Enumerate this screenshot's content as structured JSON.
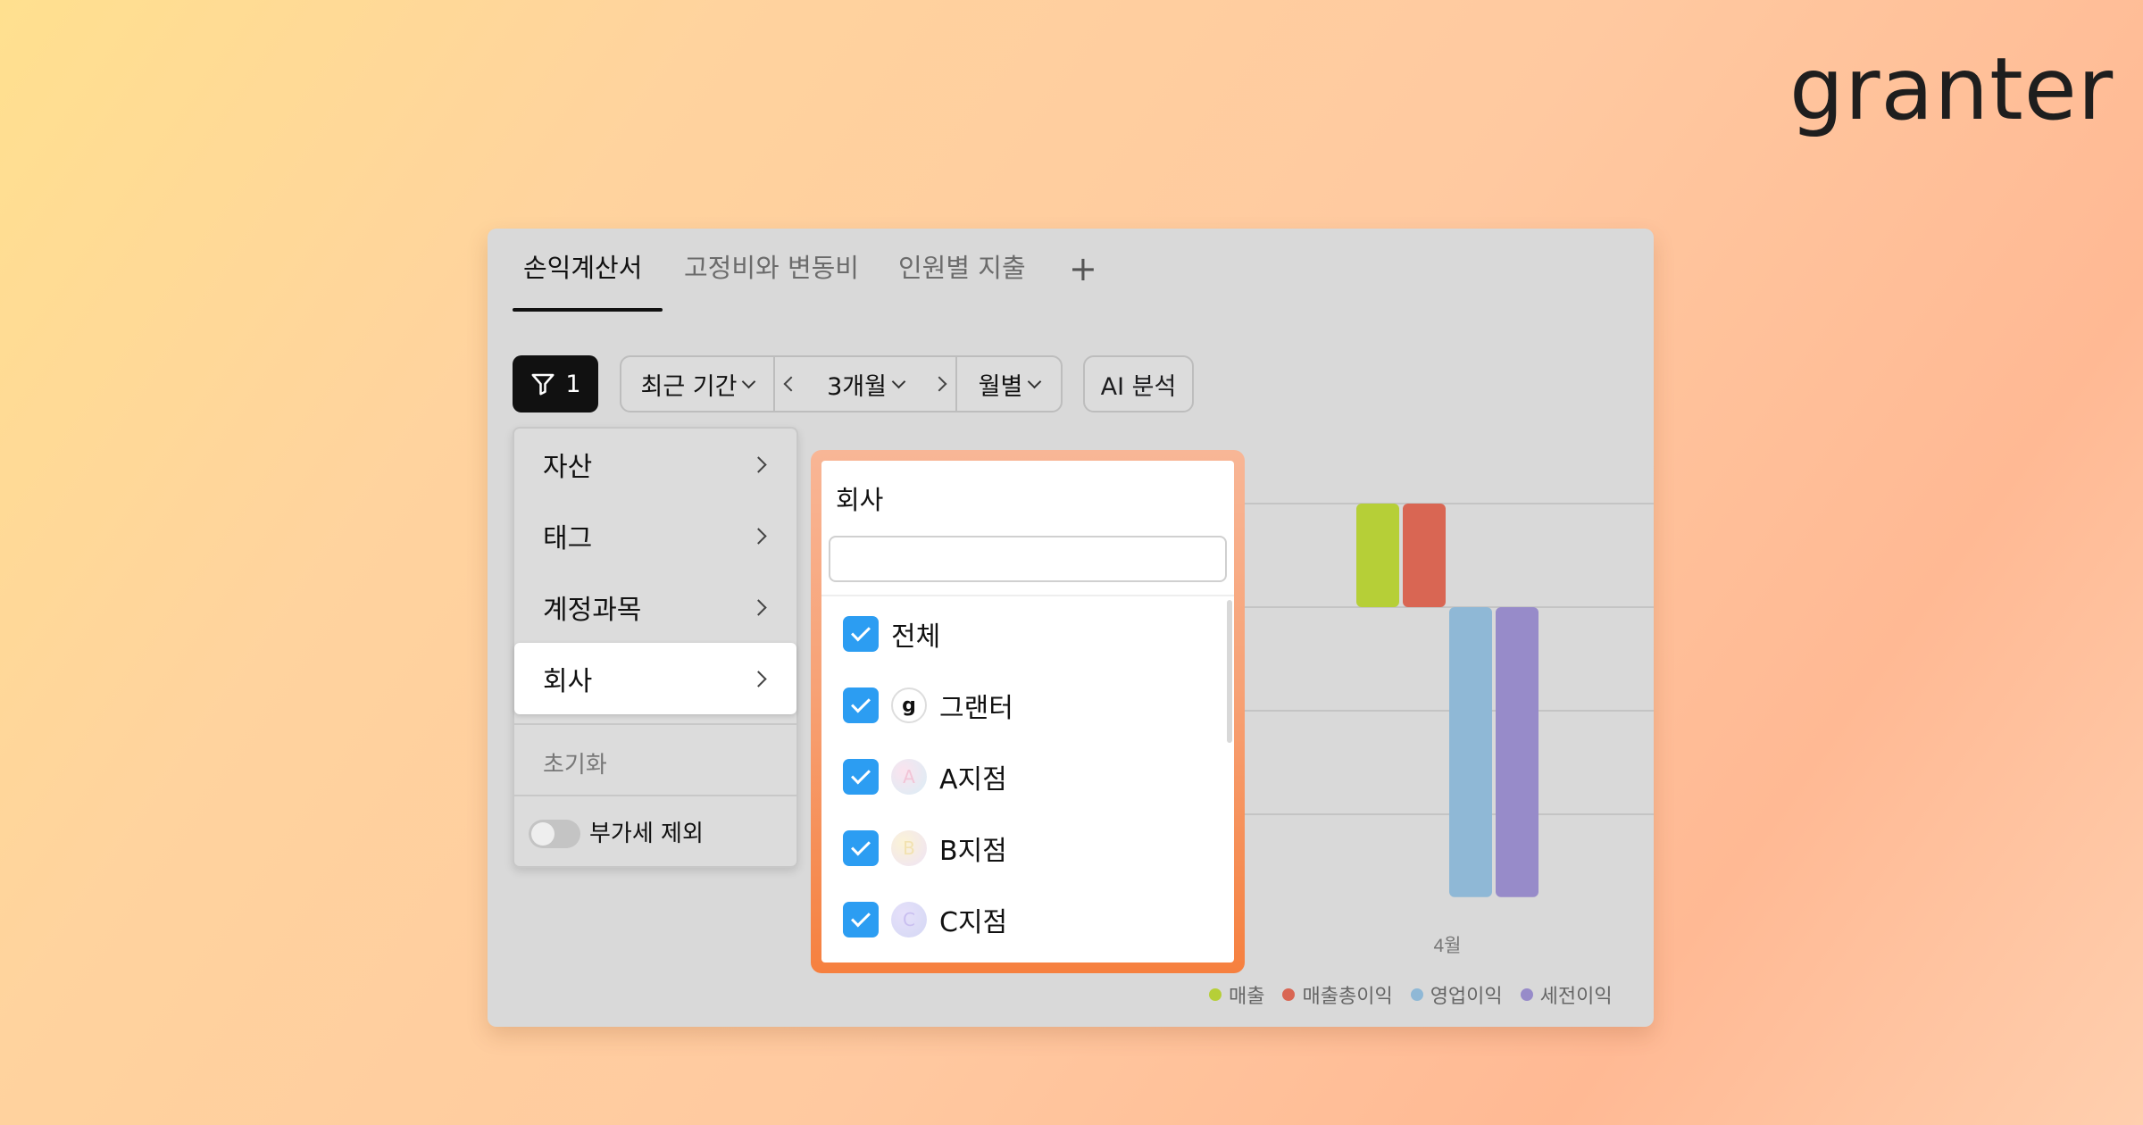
{
  "brand": {
    "logo_text": "granter"
  },
  "tabs": [
    {
      "label": "손익계산서",
      "active": true
    },
    {
      "label": "고정비와 변동비",
      "active": false
    },
    {
      "label": "인원별 지출",
      "active": false
    }
  ],
  "tab_add_label": "+",
  "toolbar": {
    "filter_count": "1",
    "period_label": "최근 기간",
    "range_label": "3개월",
    "granularity_label": "월별",
    "ai_button_label": "AI 분석"
  },
  "filter_menu": {
    "items": [
      {
        "label": "자산"
      },
      {
        "label": "태그"
      },
      {
        "label": "계정과목"
      },
      {
        "label": "회사",
        "selected": true
      }
    ],
    "reset_label": "초기화",
    "vat_toggle": {
      "label": "부가세 제외",
      "on": false
    }
  },
  "company_popup": {
    "title": "회사",
    "search_value": "",
    "options": [
      {
        "label": "전체",
        "checked": true,
        "logo": ""
      },
      {
        "label": "그랜터",
        "checked": true,
        "logo": "g"
      },
      {
        "label": "A지점",
        "checked": true,
        "logo": "A"
      },
      {
        "label": "B지점",
        "checked": true,
        "logo": "B"
      },
      {
        "label": "C지점",
        "checked": true,
        "logo": "C"
      }
    ]
  },
  "chart_data": {
    "type": "bar",
    "categories": [
      "4월"
    ],
    "series": [
      {
        "name": "매출",
        "color": "#b6cf37",
        "values": [
          1
        ]
      },
      {
        "name": "매출총이익",
        "color": "#d96653",
        "values": [
          1
        ]
      },
      {
        "name": "영업이익",
        "color": "#8fb8d6",
        "values": [
          -2.8
        ]
      },
      {
        "name": "세전이익",
        "color": "#978bc9",
        "values": [
          -2.8
        ]
      }
    ],
    "legend_position": "bottom-right",
    "grid": true
  }
}
